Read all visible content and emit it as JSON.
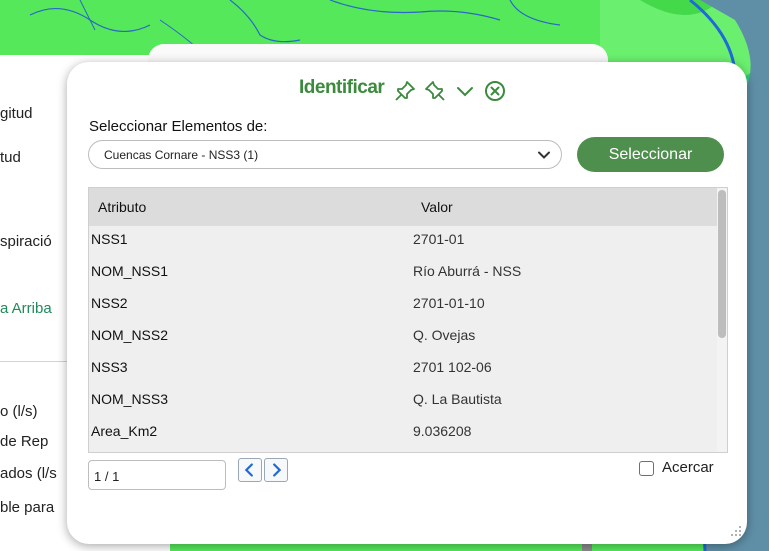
{
  "left_panel": {
    "items": [
      "gitud",
      "tud",
      "spiració",
      "a Arriba",
      "o (l/s)",
      "de Rep",
      "ados (l/s",
      "ble para"
    ]
  },
  "dialog": {
    "title": "Identificar",
    "icons": [
      "pin-icon",
      "pin-outline-icon",
      "chevron-down-icon",
      "close-circle-icon"
    ],
    "select_label": "Seleccionar Elementos de:",
    "select_value": "Cuencas Cornare - NSS3 (1)",
    "select_button": "Seleccionar",
    "table": {
      "headers": [
        "Atributo",
        "Valor"
      ],
      "rows": [
        {
          "attr": "NSS1",
          "value": "2701-01"
        },
        {
          "attr": "NOM_NSS1",
          "value": "Río Aburrá - NSS"
        },
        {
          "attr": "NSS2",
          "value": "2701-01-10"
        },
        {
          "attr": "NOM_NSS2",
          "value": "Q. Ovejas"
        },
        {
          "attr": "NSS3",
          "value": "2701 102-06"
        },
        {
          "attr": "NOM_NSS3",
          "value": "Q. La Bautista"
        },
        {
          "attr": "Area_Km2",
          "value": "9.036208"
        }
      ]
    },
    "pager_value": "1 / 1",
    "zoom_checkbox_label": "Acercar"
  },
  "colors": {
    "accent": "#3b8a3e",
    "button": "#4f8f4d",
    "map_green": "#55e85a",
    "river": "#1e6ad8"
  }
}
